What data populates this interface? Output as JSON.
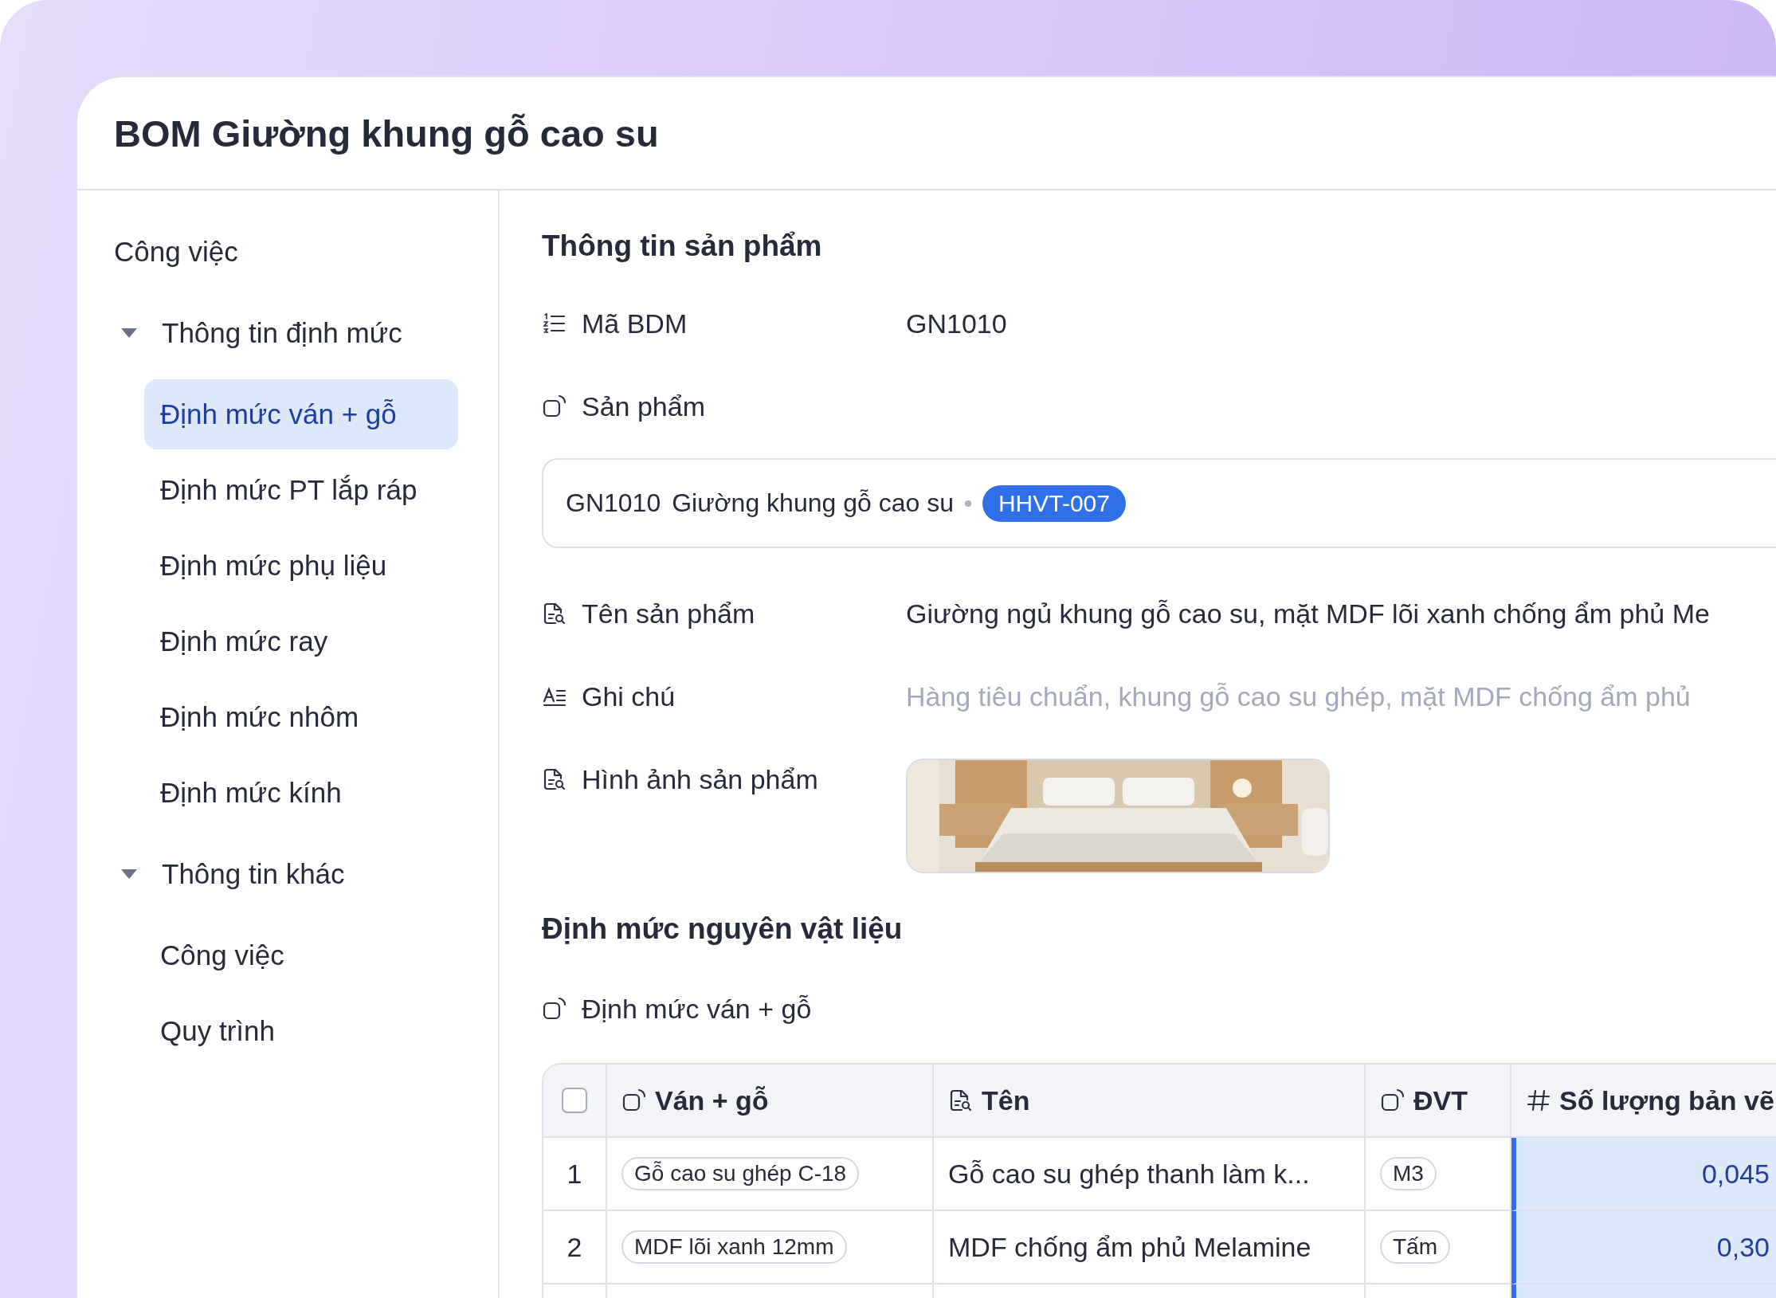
{
  "window": {
    "title": "BOM Giường khung gỗ cao su"
  },
  "sidebar": {
    "items": [
      {
        "label": "Công việc",
        "selected": false
      },
      {
        "label": "Thông tin định mức",
        "expanded": true,
        "children": [
          {
            "label": "Định mức ván + gỗ",
            "selected": true
          },
          {
            "label": "Định mức PT lắp ráp",
            "selected": false
          },
          {
            "label": "Định mức phụ liệu",
            "selected": false
          },
          {
            "label": "Định mức ray",
            "selected": false
          },
          {
            "label": "Định mức nhôm",
            "selected": false
          },
          {
            "label": "Định mức kính",
            "selected": false
          }
        ]
      },
      {
        "label": "Thông tin khác",
        "expanded": true,
        "children": [
          {
            "label": "Công việc",
            "selected": false
          },
          {
            "label": "Quy trình",
            "selected": false
          }
        ]
      }
    ]
  },
  "product_section": {
    "title": "Thông tin sản phẩm",
    "fields": [
      {
        "kind": "text",
        "label": "Mã BDM",
        "value": "GN1010"
      },
      {
        "kind": "relation",
        "label": "Sản phẩm",
        "record": {
          "code": "GN1010",
          "name": "Giường khung gỗ cao su",
          "tag": "HHVT-007"
        }
      },
      {
        "kind": "text",
        "label": "Tên sản phẩm",
        "value": "Giường ngủ khung gỗ cao su, mặt MDF lõi xanh chống ẩm phủ Me"
      },
      {
        "kind": "placeholder",
        "label": "Ghi chú",
        "placeholder": "Hàng tiêu chuẩn, khung gỗ cao su ghép, mặt MDF chống ẩm phủ"
      },
      {
        "kind": "picture",
        "label": "Hình ảnh sản phẩm"
      }
    ]
  },
  "materials_section": {
    "title": "Định mức nguyên vật liệu",
    "subsection": {
      "label": "Định mức ván + gỗ"
    },
    "table": {
      "header_checkbox": {
        "checked": false
      },
      "columns": [
        {
          "label": "Ván + gỗ",
          "selected": false
        },
        {
          "label": "Tên",
          "selected": false
        },
        {
          "label": "ĐVT",
          "selected": false
        },
        {
          "label": "Số lượng bản vẽ",
          "selected": true
        }
      ],
      "rows": [
        {
          "index": "1",
          "material": "Gỗ cao su ghép C-18",
          "name": "Gỗ cao su ghép thanh làm k...",
          "unit": "M3",
          "quantity": "0,045"
        },
        {
          "index": "2",
          "material": "MDF lõi xanh 12mm",
          "name": "MDF chống ẩm phủ Melamine",
          "unit": "Tấm",
          "quantity": "0,30"
        }
      ]
    }
  }
}
